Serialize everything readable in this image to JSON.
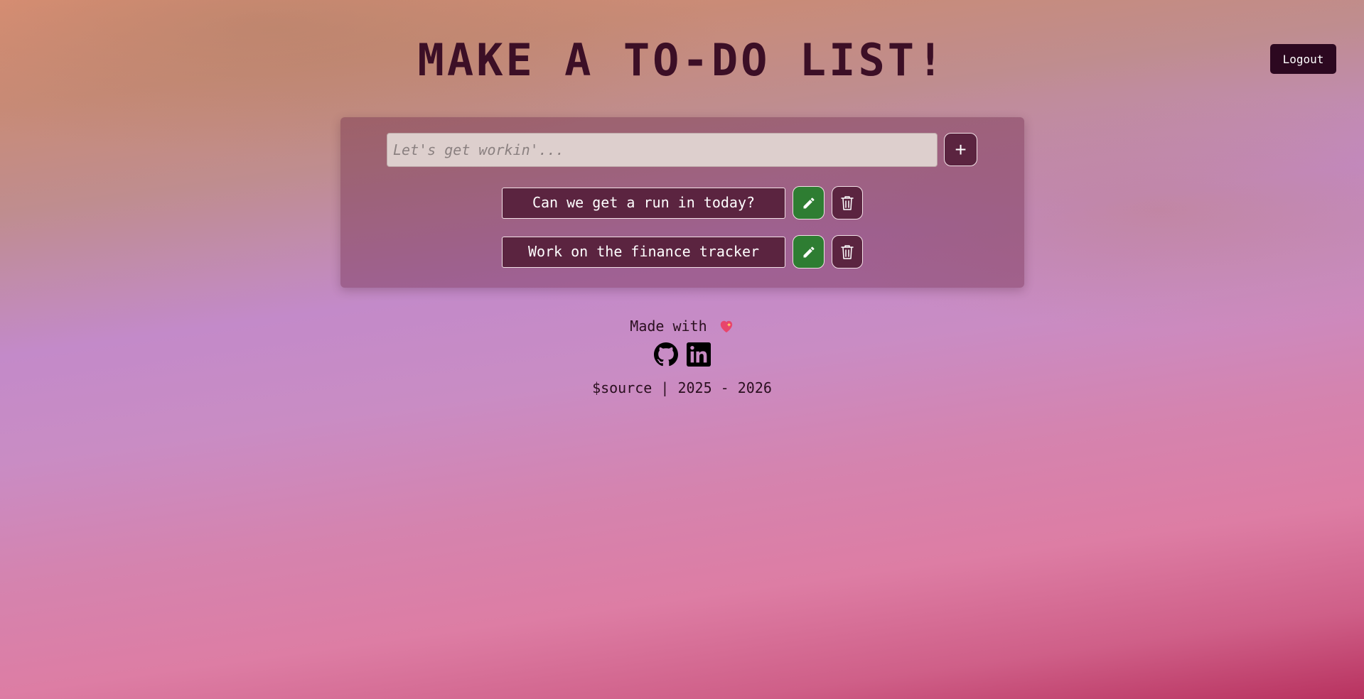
{
  "header": {
    "title": "MAKE A TO-DO LIST!",
    "logout_label": "Logout"
  },
  "composer": {
    "placeholder": "Let's get workin'...",
    "add_label": "+"
  },
  "todos": [
    {
      "text": "Can we get a run in today?",
      "edit_icon": "pencil-icon",
      "delete_icon": "trash-icon"
    },
    {
      "text": "Work on the finance tracker",
      "edit_icon": "pencil-icon",
      "delete_icon": "trash-icon"
    }
  ],
  "footer": {
    "made_with": "Made with",
    "heart_icon": "heart-icon",
    "social_icons": [
      "github-icon",
      "linkedin-icon"
    ],
    "source_text": "$source | 2025 - 2026"
  },
  "colors": {
    "title": "#3c0f26",
    "logout_bg": "#2c0820",
    "item_bg": "#5b2440",
    "edit_bg": "#2e7d32"
  }
}
